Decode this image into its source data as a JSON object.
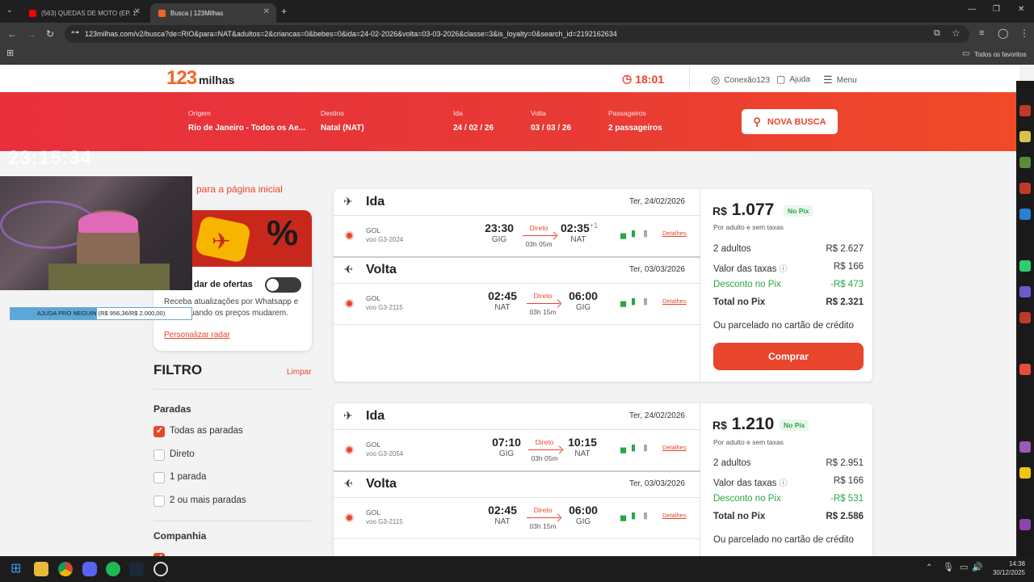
{
  "browser": {
    "tabs": [
      {
        "label": "(563) QUEDAS DE MOTO (EP. 1:",
        "active": false
      },
      {
        "label": "Busca | 123Milhas",
        "active": true
      }
    ],
    "url": "123milhas.com/v2/busca?de=RIO&para=NAT&adultos=2&criancas=0&bebes=0&ida=24-02-2026&volta=03-03-2026&classe=3&is_loyalty=0&search_id=2192162634",
    "bookmarks_label": "Todos os favoritos"
  },
  "header": {
    "logo_num": "123",
    "logo_text": "milhas",
    "timer": "18:01",
    "nav": [
      "Conexão123",
      "Ajuda",
      "Menu"
    ]
  },
  "search": {
    "origem_label": "Origem",
    "origem": "Rio de Janeiro - Todos os Ae...",
    "destino_label": "Destino",
    "destino": "Natal (NAT)",
    "ida_label": "Ida",
    "ida": "24 / 02 / 26",
    "volta_label": "Volta",
    "volta": "03 / 03 / 26",
    "pass_label": "Passageiros",
    "pass": "2 passageiros",
    "button": "NOVA BUSCA"
  },
  "sidebar": {
    "back_link": "para a página inicial",
    "radar_title": "dar de ofertas",
    "radar_text": "Receba atualizações por Whatsapp e email quando os preços mudarem.",
    "radar_link": "Personalizar radar",
    "filtro": "FILTRO",
    "limpar": "Limpar",
    "paradas_title": "Paradas",
    "paradas": [
      {
        "label": "Todas as paradas",
        "checked": true
      },
      {
        "label": "Direto",
        "checked": false
      },
      {
        "label": "1 parada",
        "checked": false
      },
      {
        "label": "2 ou mais paradas",
        "checked": false
      }
    ],
    "companhia_title": "Companhia"
  },
  "offers": [
    {
      "ida": {
        "title": "Ida",
        "date": "Ter, 24/02/2026",
        "airline": "GOL",
        "flight": "voo G3-2024",
        "dep": "23:30",
        "dep_code": "GIG",
        "type": "Direto",
        "duration": "03h 05m",
        "arr": "02:35",
        "arr_plus": "+1",
        "arr_code": "NAT",
        "details": "Detalhes"
      },
      "volta": {
        "title": "Volta",
        "date": "Ter, 03/03/2026",
        "airline": "GOL",
        "flight": "voo G3-2115",
        "dep": "02:45",
        "dep_code": "NAT",
        "type": "Direto",
        "duration": "03h 15m",
        "arr": "06:00",
        "arr_plus": "",
        "arr_code": "GIG",
        "details": "Detalhes"
      },
      "price": {
        "currency": "R$",
        "value": "1.077",
        "badge": "No Pix",
        "note": "Por adulto e sem taxas",
        "rows": [
          {
            "label": "2 adultos",
            "value": "R$ 2.627"
          },
          {
            "label": "Valor das taxas",
            "value": "R$ 166"
          },
          {
            "label": "Desconto no Pix",
            "value": "-R$ 473"
          },
          {
            "label": "Total no Pix",
            "value": "R$ 2.321"
          }
        ],
        "installments": "Ou parcelado no cartão de crédito",
        "button": "Comprar"
      }
    },
    {
      "ida": {
        "title": "Ida",
        "date": "Ter, 24/02/2026",
        "airline": "GOL",
        "flight": "voo G3-2054",
        "dep": "07:10",
        "dep_code": "GIG",
        "type": "Direto",
        "duration": "03h 05m",
        "arr": "10:15",
        "arr_plus": "",
        "arr_code": "NAT",
        "details": "Detalhes"
      },
      "volta": {
        "title": "Volta",
        "date": "Ter, 03/03/2026",
        "airline": "GOL",
        "flight": "voo G3-2115",
        "dep": "02:45",
        "dep_code": "NAT",
        "type": "Direto",
        "duration": "03h 15m",
        "arr": "06:00",
        "arr_plus": "",
        "arr_code": "GIG",
        "details": "Detalhes"
      },
      "price": {
        "currency": "R$",
        "value": "1.210",
        "badge": "No Pix",
        "note": "Por adulto e sem taxas",
        "rows": [
          {
            "label": "2 adultos",
            "value": "R$ 2.951"
          },
          {
            "label": "Valor das taxas",
            "value": "R$ 166"
          },
          {
            "label": "Desconto no Pix",
            "value": "-R$ 531"
          },
          {
            "label": "Total no Pix",
            "value": "R$ 2.586"
          }
        ],
        "installments": "Ou parcelado no cartão de crédito"
      }
    }
  ],
  "overlay": {
    "clock": "23:15:34",
    "donation": "AJUDA PRO NEGUIN (R$ 956,36/R$ 2.000,00)",
    "donation_progress": 0.478
  },
  "taskbar": {
    "time": "14:38",
    "date": "30/12/2025"
  },
  "colors": {
    "brand_red": "#e8452d",
    "band_red": "#e8303d",
    "pix_green": "#28a745"
  }
}
